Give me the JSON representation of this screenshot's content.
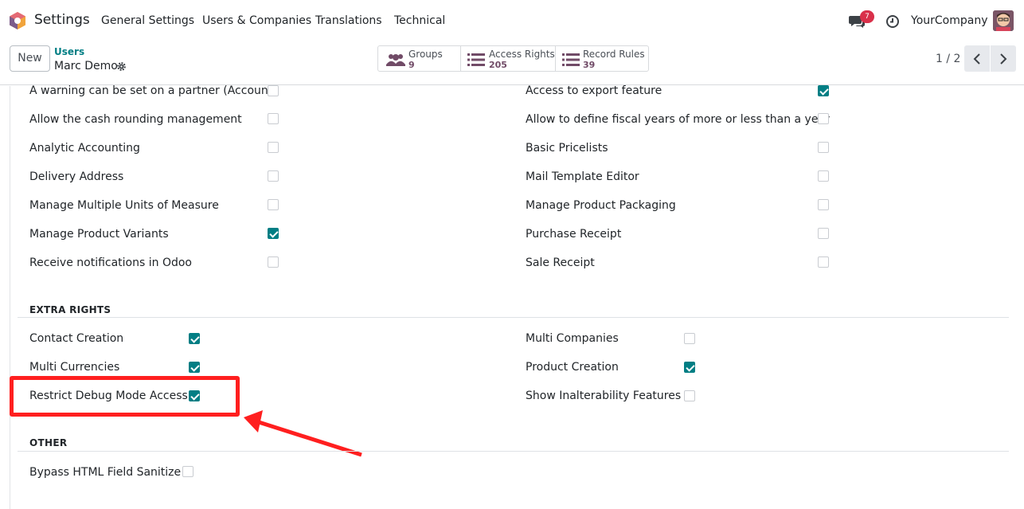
{
  "topbar": {
    "app_name": "Settings",
    "menu": [
      "General Settings",
      "Users & Companies",
      "Translations",
      "Technical"
    ],
    "notification_count": "7",
    "company": "YourCompany"
  },
  "control": {
    "new_label": "New",
    "breadcrumb_parent": "Users",
    "record_name": "Marc Demo",
    "smart_buttons": [
      {
        "label": "Groups",
        "count": "9"
      },
      {
        "label": "Access Rights",
        "count": "205"
      },
      {
        "label": "Record Rules",
        "count": "39"
      }
    ],
    "pager": "1 / 2"
  },
  "technical_left": [
    {
      "label": "A warning can be set on a partner (Account)",
      "checked": false
    },
    {
      "label": "Allow the cash rounding management",
      "checked": false
    },
    {
      "label": "Analytic Accounting",
      "checked": false
    },
    {
      "label": "Delivery Address",
      "checked": false
    },
    {
      "label": "Manage Multiple Units of Measure",
      "checked": false
    },
    {
      "label": "Manage Product Variants",
      "checked": true
    },
    {
      "label": "Receive notifications in Odoo",
      "checked": false
    }
  ],
  "technical_right": [
    {
      "label": "Access to export feature",
      "checked": true
    },
    {
      "label": "Allow to define fiscal years of more or less than a year",
      "checked": false
    },
    {
      "label": "Basic Pricelists",
      "checked": false
    },
    {
      "label": "Mail Template Editor",
      "checked": false
    },
    {
      "label": "Manage Product Packaging",
      "checked": false
    },
    {
      "label": "Purchase Receipt",
      "checked": false
    },
    {
      "label": "Sale Receipt",
      "checked": false
    }
  ],
  "extra_rights": {
    "title": "EXTRA RIGHTS",
    "left": [
      {
        "label": "Contact Creation",
        "checked": true
      },
      {
        "label": "Multi Currencies",
        "checked": true
      },
      {
        "label": "Restrict Debug Mode Access",
        "checked": true
      }
    ],
    "right": [
      {
        "label": "Multi Companies",
        "checked": false
      },
      {
        "label": "Product Creation",
        "checked": true
      },
      {
        "label": "Show Inalterability Features",
        "checked": false
      }
    ]
  },
  "other": {
    "title": "OTHER",
    "items": [
      {
        "label": "Bypass HTML Field Sanitize",
        "checked": false
      }
    ]
  },
  "colors": {
    "accent": "#017e84",
    "brand": "#714b67",
    "annotation": "#ff1f1f"
  }
}
